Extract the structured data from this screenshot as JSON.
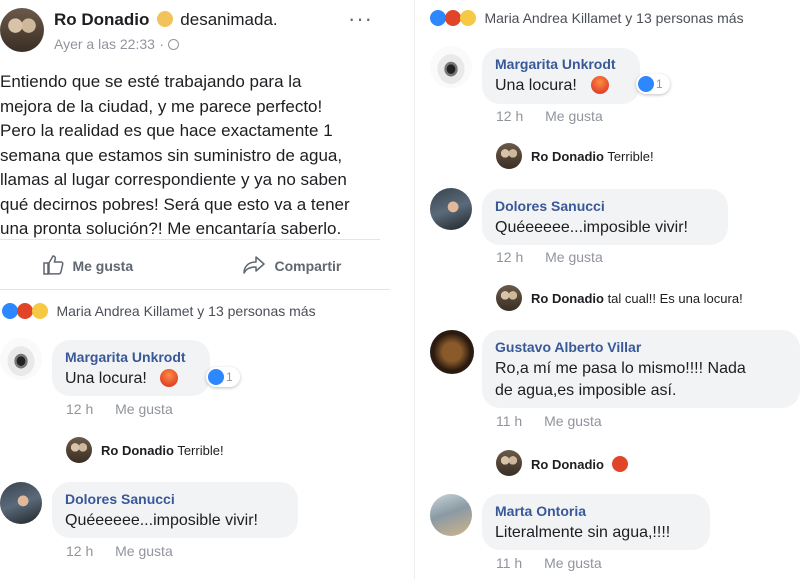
{
  "post": {
    "author": "Ro Donadio",
    "feeling": "desanimada.",
    "time": "Ayer a las 22:33",
    "privacy_icon": "globe-icon",
    "more_icon": "more-icon",
    "text_lines": [
      "Entiendo que se esté trabajando para la",
      "mejora de la ciudad, y me parece perfecto!",
      "Pero la realidad es que hace exactamente 1",
      "semana que estamos sin suministro de agua,",
      "llamas al lugar correspondiente y ya no saben",
      "qué decirnos pobres! Será que esto va a tener",
      "una pronta solución?! Me encantaría saberlo."
    ],
    "actions": {
      "like": "Me gusta",
      "share": "Compartir"
    }
  },
  "reactions_summary": "Maria Andrea Killamet y 13 personas más",
  "comments": [
    {
      "author": "Margarita Unkrodt",
      "text": "Una locura!",
      "time": "12 h",
      "like": "Me gusta",
      "reaction_count": "1",
      "reply": {
        "author": "Ro Donadio",
        "text": "Terrible!"
      }
    },
    {
      "author": "Dolores Sanucci",
      "text": "Quéeeeee...imposible vivir!",
      "time": "12 h",
      "like": "Me gusta",
      "reply": {
        "author": "Ro Donadio",
        "text": "tal cual!! Es una locura!"
      }
    },
    {
      "author": "Gustavo Alberto Villar",
      "text_lines": [
        "Ro,a mí me pasa lo mismo!!!! Nada",
        "de agua,es imposible así."
      ],
      "time": "11 h",
      "like": "Me gusta",
      "reply": {
        "author": "Ro Donadio",
        "text": ""
      }
    },
    {
      "author": "Marta Ontoria",
      "text": "Literalmente sin agua,!!!!",
      "time": "11 h",
      "like": "Me gusta"
    }
  ],
  "colors": {
    "link_name": "#385898",
    "like_blue": "#2d88ff",
    "angry": "#e0452a",
    "bubble": "#f2f3f5",
    "muted": "#90949c"
  }
}
